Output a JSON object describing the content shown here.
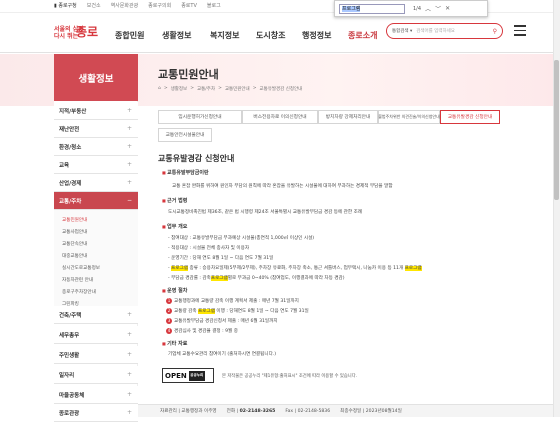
{
  "util": {
    "home": "▮ 종로구청",
    "links": [
      "보건소",
      "역사문화관광",
      "종로구의회",
      "종로TV",
      "블로그"
    ]
  },
  "find": {
    "query": "프로그램",
    "count": "1/4"
  },
  "logo": {
    "line1": "서울의 심장",
    "line2": "다시 뛰는",
    "brand": "종로"
  },
  "gnb": [
    {
      "label": "종합민원"
    },
    {
      "label": "생활정보"
    },
    {
      "label": "복지정보"
    },
    {
      "label": "도시창조"
    },
    {
      "label": "행정정보"
    },
    {
      "label": "종로소개"
    }
  ],
  "search": {
    "scope": "통합검색 ▾",
    "placeholder": "검색어를 입력하세요"
  },
  "side_title": "생활정보",
  "page_title": "교통민원안내",
  "breadcrumb": [
    "⌂",
    ">",
    "생활정보",
    ">",
    "교통/주차",
    ">",
    "교통민원안내",
    ">",
    "교통유발경감 신청안내"
  ],
  "sidebar": {
    "items": [
      {
        "label": "지적/부동산",
        "mark": "+"
      },
      {
        "label": "재난안전",
        "mark": "+"
      },
      {
        "label": "환경/청소",
        "mark": "+"
      },
      {
        "label": "교육",
        "mark": "+"
      },
      {
        "label": "산업/경제",
        "mark": "+"
      },
      {
        "label": "교통/주차",
        "mark": "−"
      },
      {
        "label": "건축/주택",
        "mark": "+"
      },
      {
        "label": "세무총무",
        "mark": "+"
      },
      {
        "label": "주민생활",
        "mark": "+"
      },
      {
        "label": "일자리",
        "mark": "+"
      },
      {
        "label": "마을공동체",
        "mark": "+"
      },
      {
        "label": "종로관광",
        "mark": "+"
      }
    ],
    "subs": [
      "교통민원안내",
      "교통사업안내",
      "교통단속안내",
      "대중교통안내",
      "실시간도로교통정보",
      "자동차관련 안내",
      "종로구주차장안내",
      "그린파킹"
    ]
  },
  "tabs": [
    "임시운행허가신청안내",
    "버스전용차로 이의신청안내",
    "방치차량 강제처리안내",
    "불법주차위반 의견진술/이의신청안내",
    "교통유발경감 신청안내",
    "교통안전시설물안내"
  ],
  "section_title": "교통유발경감 신청안내",
  "content": {
    "h1": "교통유발부담금이란",
    "p1": "교통 혼잡 완화를 위하여 원인자 부담의 원칙에 따라 혼잡을 유발하는 시설물에 대하여 부과하는 경제적 부담을 말함",
    "h2": "근거 법령",
    "p2": "도시교통정비촉진법 제36조, 같은 법 시행령 제24조 서울특별시 교통유발부담금 경감 등에 관한 조례",
    "h3": "업무 개요",
    "o1": "- 참여대상 : 교통유발부담금 부과예상 시설물(총연적 1,000㎡ 이상인 시설)",
    "o2": "- 적용대상 : 시설물 전체 종사자 및 이용자",
    "o3": "- 운영기간 : 당해 연도 8월 1일 ~ 다음 연도 7월 31일",
    "o4a": "- ",
    "o4hl": "프로그램",
    "o4b": " 종류 : 승용차요일제(5부제/2부제), 주차장 유료화, 주차장 축소, 통근 셔틀버스, 업무택시, 나눔카 이용 등 11개 ",
    "o4hl2": "프로그램",
    "o5a": "- 부담금 경감률 : 감축",
    "o5hl": "프로그램",
    "o5b": "별로 부과금 0~40% (참여업도, 이행결과에 따라 차등 경감)",
    "h4": "운영 절차",
    "s1": "교통행정과에 교통량 감축 이행 계획서 제출 : 매년 7월 31일까지",
    "s2a": "교통량 감축 ",
    "s2hl": "프로그램",
    "s2b": " 이행 : 당해연도 8월 1일 ~ 다음 연도 7월 31일",
    "s3": "교통유발부담금 경감신청서 제출 : 매년 6월 31일까지",
    "s4": "경감심사 및 경감율 결정 : 9월 중",
    "h5": "기타 자료",
    "p5": "기업체 교통수요관리 참여이기 (출처하시면 연결됩니다.)"
  },
  "kogl": {
    "open": "OPEN",
    "badge": "공공누리",
    "note": "본 저작물은 공공누리 \"제1유형:출처표시\" 조건에 따라 이용할 수 있습니다."
  },
  "footer": {
    "dept_label": "자료관리",
    "dept": "교통행정과 이주영",
    "phone_label": "전화",
    "phone": "02-2148-3265",
    "fax_label": "Fax",
    "fax": "02-2148-5836",
    "updated_label": "최종수정일",
    "updated": "2023년08월14일"
  }
}
